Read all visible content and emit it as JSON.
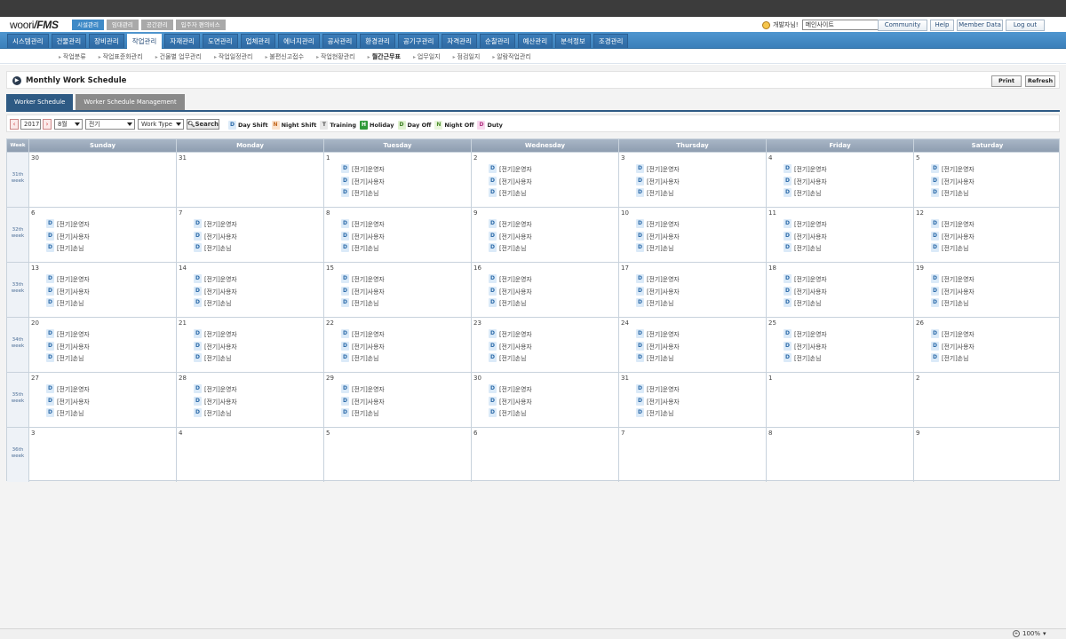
{
  "header": {
    "logo_main": "woori",
    "logo_sub": "/FMS",
    "top_tabs": [
      {
        "label": "시설관리",
        "active": true
      },
      {
        "label": "임대관리",
        "active": false
      },
      {
        "label": "공간관리",
        "active": false
      },
      {
        "label": "입주자 편의비스",
        "active": false
      }
    ],
    "user_text": "개발자님!",
    "site_select": "메인사이트",
    "links": [
      "Community",
      "Help",
      "Member Data",
      "Log out"
    ]
  },
  "nav": {
    "items": [
      "시스템관리",
      "건물관리",
      "장비관리",
      "작업관리",
      "자재관리",
      "도면관리",
      "업체관리",
      "에너지관리",
      "공사관리",
      "환경관리",
      "공기구관리",
      "자격관리",
      "순찰관리",
      "예산관리",
      "분석정보",
      "조경관리"
    ],
    "active_index": 3
  },
  "subnav": {
    "items": [
      "작업분류",
      "작업표준화관리",
      "건물별 업무관리",
      "작업일정관리",
      "불편신고접수",
      "작업현황관리",
      "월간근무표",
      "업무일지",
      "점검일지",
      "알람작업관리"
    ],
    "active_index": 6
  },
  "page": {
    "title": "Monthly Work Schedule",
    "print_label": "Print",
    "refresh_label": "Refresh",
    "tabs": [
      {
        "label": "Worker Schedule",
        "active": true
      },
      {
        "label": "Worker Schedule Management",
        "active": false
      }
    ]
  },
  "filter": {
    "prev": "‹",
    "year": "2017",
    "next": "›",
    "month": "8월",
    "dept": "전기",
    "work_type": "Work Type",
    "search_label": "Search",
    "legend": [
      {
        "code": "D",
        "label": "Day Shift",
        "cls": "b-D"
      },
      {
        "code": "N",
        "label": "Night Shift",
        "cls": "b-N"
      },
      {
        "code": "T",
        "label": "Training",
        "cls": "b-T"
      },
      {
        "code": "H",
        "label": "Holiday",
        "cls": "b-H"
      },
      {
        "code": "D",
        "label": "Day Off",
        "cls": "b-DO"
      },
      {
        "code": "N",
        "label": "Night Off",
        "cls": "b-NO"
      },
      {
        "code": "D",
        "label": "Duty",
        "cls": "b-DU"
      }
    ]
  },
  "calendar": {
    "week_header": "Week",
    "days": [
      "Sunday",
      "Monday",
      "Tuesday",
      "Wednesday",
      "Thursday",
      "Friday",
      "Saturday"
    ],
    "week_suffix": "week",
    "weeks": [
      {
        "label": "31th",
        "dates": [
          "30",
          "31",
          "1",
          "2",
          "3",
          "4",
          "5"
        ],
        "filled": [
          false,
          false,
          true,
          true,
          true,
          true,
          true
        ]
      },
      {
        "label": "32th",
        "dates": [
          "6",
          "7",
          "8",
          "9",
          "10",
          "11",
          "12"
        ],
        "filled": [
          true,
          true,
          true,
          true,
          true,
          true,
          true
        ]
      },
      {
        "label": "33th",
        "dates": [
          "13",
          "14",
          "15",
          "16",
          "17",
          "18",
          "19"
        ],
        "filled": [
          true,
          true,
          true,
          true,
          true,
          true,
          true
        ]
      },
      {
        "label": "34th",
        "dates": [
          "20",
          "21",
          "22",
          "23",
          "24",
          "25",
          "26"
        ],
        "filled": [
          true,
          true,
          true,
          true,
          true,
          true,
          true
        ]
      },
      {
        "label": "35th",
        "dates": [
          "27",
          "28",
          "29",
          "30",
          "31",
          "1",
          "2"
        ],
        "filled": [
          true,
          true,
          true,
          true,
          true,
          false,
          false
        ]
      },
      {
        "label": "36th",
        "dates": [
          "3",
          "4",
          "5",
          "6",
          "7",
          "8",
          "9"
        ],
        "filled": [
          false,
          false,
          false,
          false,
          false,
          false,
          false
        ]
      }
    ],
    "entries": [
      {
        "code": "D",
        "text": "[전기]운영자"
      },
      {
        "code": "D",
        "text": "[전기]사용자"
      },
      {
        "code": "D",
        "text": "[전기]손님"
      }
    ]
  },
  "status": {
    "zoom": "100%"
  }
}
